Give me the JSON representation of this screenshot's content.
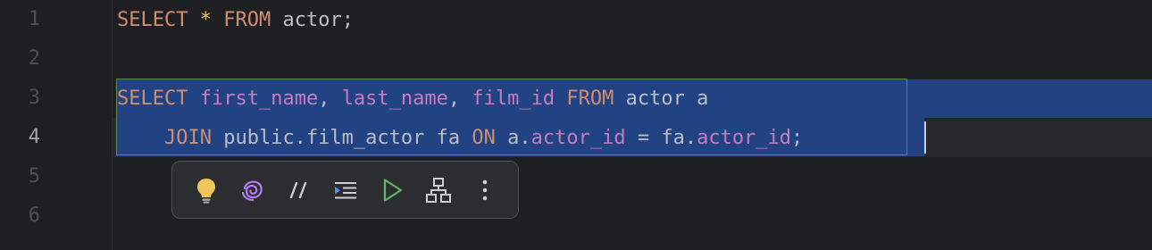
{
  "editor": {
    "line_numbers": [
      "1",
      "2",
      "3",
      "4",
      "5",
      "6"
    ],
    "current_line": "4",
    "lines": [
      [
        {
          "t": "SELECT",
          "c": "kw"
        },
        {
          "t": " ",
          "c": "plain"
        },
        {
          "t": "*",
          "c": "star"
        },
        {
          "t": " ",
          "c": "plain"
        },
        {
          "t": "FROM",
          "c": "kw"
        },
        {
          "t": " actor;",
          "c": "plain"
        }
      ],
      [],
      [
        {
          "t": "SELECT",
          "c": "kw"
        },
        {
          "t": " ",
          "c": "plain"
        },
        {
          "t": "first_name",
          "c": "col"
        },
        {
          "t": ", ",
          "c": "plain"
        },
        {
          "t": "last_name",
          "c": "col"
        },
        {
          "t": ", ",
          "c": "plain"
        },
        {
          "t": "film_id",
          "c": "col"
        },
        {
          "t": " ",
          "c": "plain"
        },
        {
          "t": "FROM",
          "c": "kw"
        },
        {
          "t": " actor a",
          "c": "plain"
        }
      ],
      [
        {
          "t": "    ",
          "c": "plain"
        },
        {
          "t": "JOIN",
          "c": "kw"
        },
        {
          "t": " public.film_actor fa ",
          "c": "plain"
        },
        {
          "t": "ON",
          "c": "kw"
        },
        {
          "t": " a.",
          "c": "plain"
        },
        {
          "t": "actor_id",
          "c": "col"
        },
        {
          "t": " = fa.",
          "c": "plain"
        },
        {
          "t": "actor_id",
          "c": "col"
        },
        {
          "t": ";",
          "c": "plain"
        }
      ],
      [],
      []
    ]
  },
  "colors": {
    "background": "#1e1f22",
    "selection": "#214283",
    "keyword": "#cf8e6d",
    "column": "#c77dbb",
    "text": "#bcbec4"
  },
  "toolbar": {
    "icons": [
      "lightbulb-icon",
      "ai-assistant-icon",
      "comment-icon",
      "reformat-icon",
      "run-icon",
      "structure-icon",
      "more-icon"
    ]
  }
}
